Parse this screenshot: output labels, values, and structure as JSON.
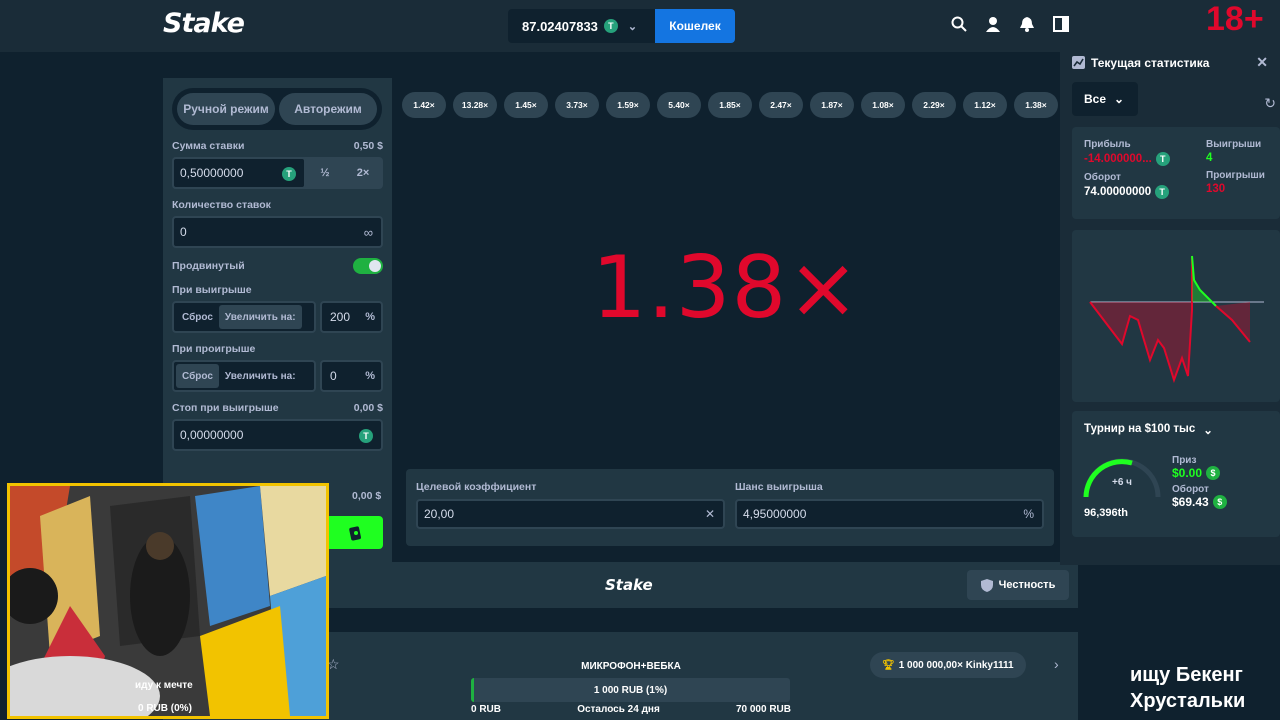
{
  "header": {
    "logo": "Stake",
    "balance": "87.02407833",
    "wallet_label": "Кошелек",
    "age_badge": "18+",
    "icons": [
      "search-icon",
      "user-icon",
      "bell-icon",
      "panel-toggle-icon"
    ]
  },
  "bet_panel": {
    "mode_manual": "Ручной режим",
    "mode_auto": "Авторежим",
    "bet_amount_label": "Сумма ставки",
    "bet_amount_usd": "0,50 $",
    "bet_amount_value": "0,50000000",
    "half": "½",
    "double": "2×",
    "bet_count_label": "Количество ставок",
    "bet_count_value": "0",
    "infinity": "∞",
    "advanced_label": "Продвинутый",
    "on_win_label": "При выигрыше",
    "on_win_reset": "Сброс",
    "on_win_increase": "Увеличить на:",
    "on_win_value": "200",
    "on_loss_label": "При проигрыше",
    "on_loss_reset": "Сброс",
    "on_loss_increase": "Увеличить на:",
    "on_loss_value": "0",
    "percent": "%",
    "stop_win_label": "Стоп при выигрыше",
    "stop_win_usd": "0,00 $",
    "stop_win_value": "0,00000000",
    "stop_loss_usd": "0,00 $"
  },
  "game": {
    "history": [
      "1.42×",
      "13.28×",
      "1.45×",
      "3.73×",
      "1.59×",
      "5.40×",
      "1.85×",
      "2.47×",
      "1.87×",
      "1.08×",
      "2.29×",
      "1.12×",
      "1.38×"
    ],
    "multiplier": "1.38×",
    "target_label": "Целевой коэффициент",
    "target_value": "20,00",
    "target_clear": "✕",
    "chance_label": "Шанс выигрыша",
    "chance_value": "4,95000000",
    "chance_unit": "%"
  },
  "footer": {
    "logo": "Stake",
    "fairness_label": "Честность"
  },
  "stats": {
    "title": "Текущая статистика",
    "filter": "Все",
    "profit_label": "Прибыль",
    "profit_value": "-14.000000...",
    "wins_label": "Выигрыши",
    "wins_value": "4",
    "wagered_label": "Оборот",
    "wagered_value": "74.00000000",
    "losses_label": "Проигрыши",
    "losses_value": "130",
    "colors": {
      "loss": "#e0082c",
      "win": "#1fff20"
    }
  },
  "tournament": {
    "title": "Турнир на $100 тыс",
    "time": "+6 ч",
    "rank": "96,396th",
    "prize_label": "Приз",
    "prize_value": "$0.00",
    "wagered_label": "Оборот",
    "wagered_value": "$69.43"
  },
  "race": {
    "title": "МИКРОФОН+ВЕБКА",
    "progress_text": "1 000 RUB (1%)",
    "progress": 0.01,
    "left": "0 RUB",
    "remaining": "Осталось 24 дня",
    "right": "70 000 RUB",
    "leader": "1 000 000,00× Kinky1111"
  },
  "stream": {
    "cam_text1": "иду к мечте",
    "cam_text2": "0 RUB (0%)",
    "caption_line1": "ищу Бекенг",
    "caption_line2": "Хрустальки"
  }
}
